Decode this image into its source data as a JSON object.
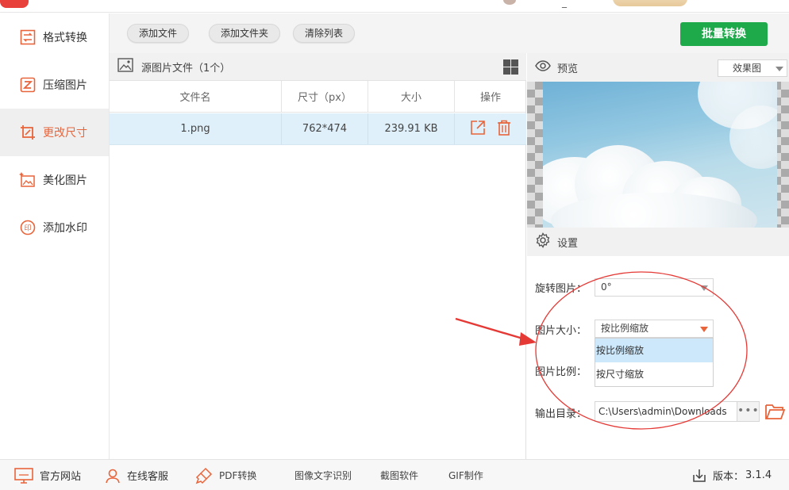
{
  "sidebar": {
    "items": [
      {
        "label": "格式转换",
        "active": false
      },
      {
        "label": "压缩图片",
        "active": false
      },
      {
        "label": "更改尺寸",
        "active": true
      },
      {
        "label": "美化图片",
        "active": false
      },
      {
        "label": "添加水印",
        "active": false
      }
    ]
  },
  "toolbar": {
    "add_file": "添加文件",
    "add_folder": "添加文件夹",
    "clear_list": "清除列表",
    "batch_convert": "批量转换"
  },
  "file_panel": {
    "title": "源图片文件（1个）",
    "columns": [
      "文件名",
      "尺寸（px）",
      "大小",
      "操作"
    ],
    "rows": [
      {
        "name": "1.png",
        "dimensions": "762*474",
        "size": "239.91 KB"
      }
    ]
  },
  "preview": {
    "title": "预览",
    "mode": "效果图"
  },
  "settings": {
    "title": "设置",
    "rotate_label": "旋转图片：",
    "rotate_value": "0°",
    "size_label": "图片大小：",
    "size_value": "按比例缩放",
    "size_options": [
      "按比例缩放",
      "按尺寸缩放"
    ],
    "ratio_label": "图片比例：",
    "output_label": "输出目录：",
    "output_path": "C:\\Users\\admin\\Downloads",
    "browse": "•••"
  },
  "bottombar": {
    "website": "官方网站",
    "support": "在线客服",
    "pdf": "PDF转换",
    "ocr": "图像文字识别",
    "screenshot": "截图软件",
    "gif": "GIF制作",
    "version_label": "版本：",
    "version": "3.1.4"
  },
  "topbar": {
    "minimize": "_"
  },
  "colors": {
    "accent": "#e8643a",
    "primary_green": "#1eaa4a",
    "row_highlight": "#dff0fb",
    "annotation_red": "#e53935"
  }
}
